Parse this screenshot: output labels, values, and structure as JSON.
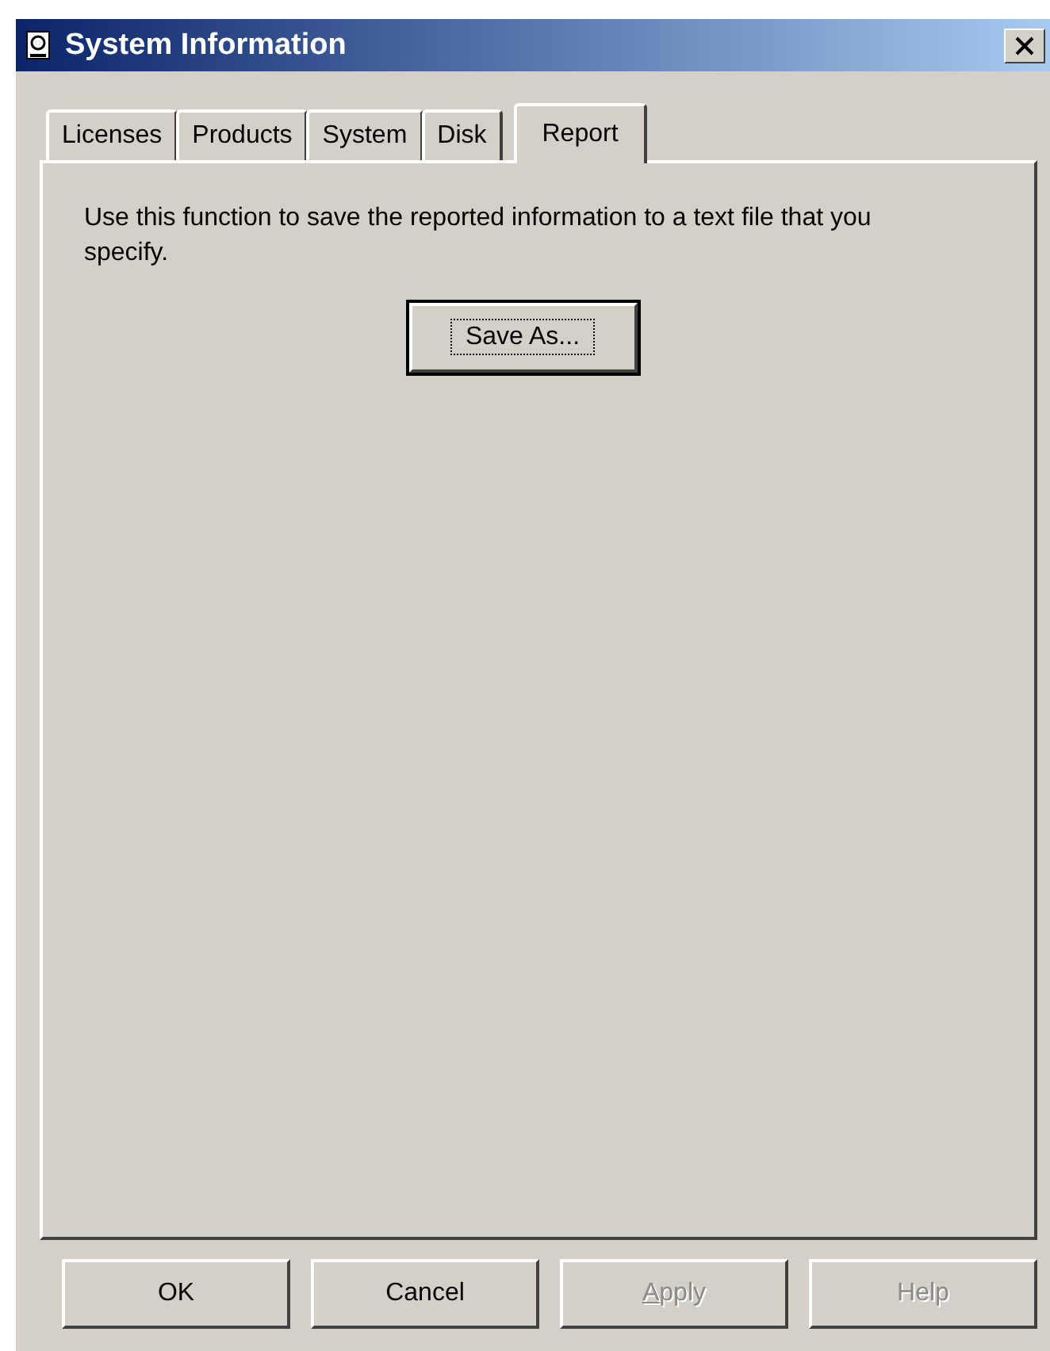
{
  "window": {
    "title": "System Information"
  },
  "tabs": [
    {
      "label": "Licenses",
      "selected": false
    },
    {
      "label": "Products",
      "selected": false
    },
    {
      "label": "System",
      "selected": false
    },
    {
      "label": "Disk",
      "selected": false
    },
    {
      "label": "Report",
      "selected": true
    }
  ],
  "panel": {
    "description": "Use this function to save the reported information to a text file that you specify.",
    "button": "Save As..."
  },
  "buttons": [
    {
      "label": "OK",
      "disabled": false,
      "underline_first": false
    },
    {
      "label": "Cancel",
      "disabled": false,
      "underline_first": false
    },
    {
      "label": "Apply",
      "disabled": true,
      "underline_first": true
    },
    {
      "label": "Help",
      "disabled": true,
      "underline_first": false
    }
  ]
}
